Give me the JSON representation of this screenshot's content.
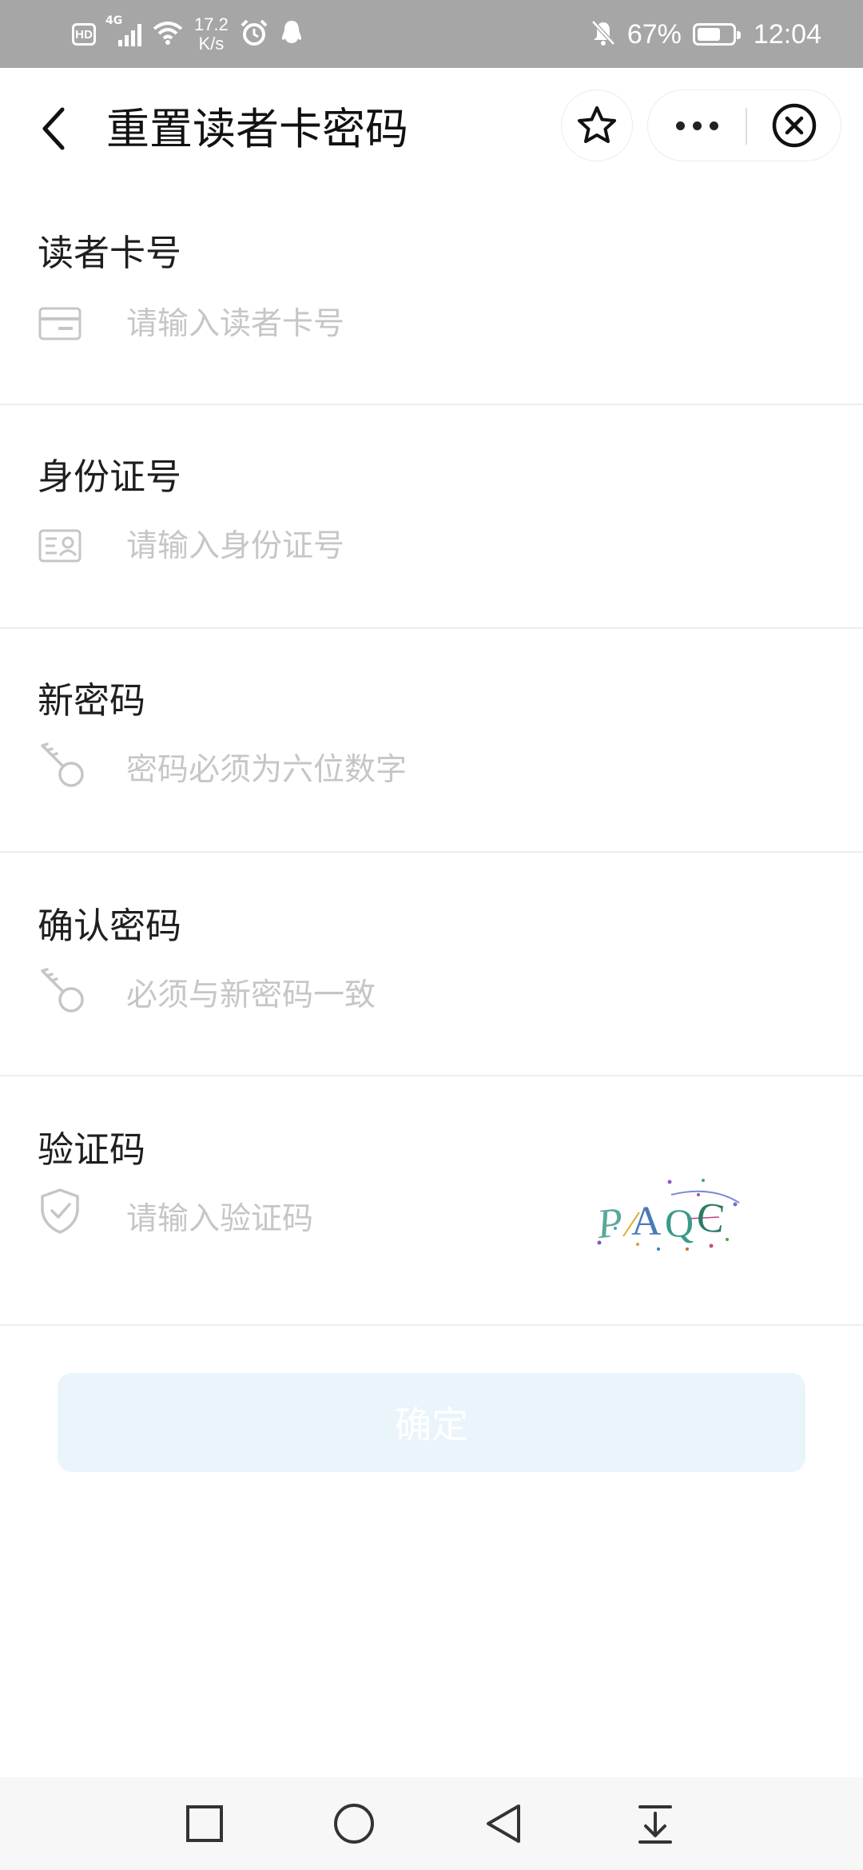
{
  "status_bar": {
    "hd": "HD",
    "network": "4G",
    "speed_value": "17.2",
    "speed_unit": "K/s",
    "battery_percent": "67%",
    "battery_level": 0.67,
    "time": "12:04"
  },
  "header": {
    "title": "重置读者卡密码"
  },
  "form": {
    "card_number": {
      "label": "读者卡号",
      "placeholder": "请输入读者卡号",
      "icon": "card-icon"
    },
    "id_number": {
      "label": "身份证号",
      "placeholder": "请输入身份证号",
      "icon": "id-card-icon"
    },
    "new_password": {
      "label": "新密码",
      "placeholder": "密码必须为六位数字",
      "icon": "key-icon"
    },
    "confirm_password": {
      "label": "确认密码",
      "placeholder": "必须与新密码一致",
      "icon": "key-icon"
    },
    "captcha": {
      "label": "验证码",
      "placeholder": "请输入验证码",
      "icon": "shield-check-icon",
      "code": "PAQC"
    }
  },
  "confirm_button": {
    "label": "确定"
  },
  "colors": {
    "status_bar": "#a6a6a6",
    "button_disabled_bg": "#eaf4fb",
    "placeholder": "#c6c6c6",
    "divider": "#ededed"
  },
  "nav_bar": {
    "buttons": [
      "square-icon",
      "circle-home-icon",
      "triangle-back-icon",
      "notification-down-icon"
    ]
  }
}
